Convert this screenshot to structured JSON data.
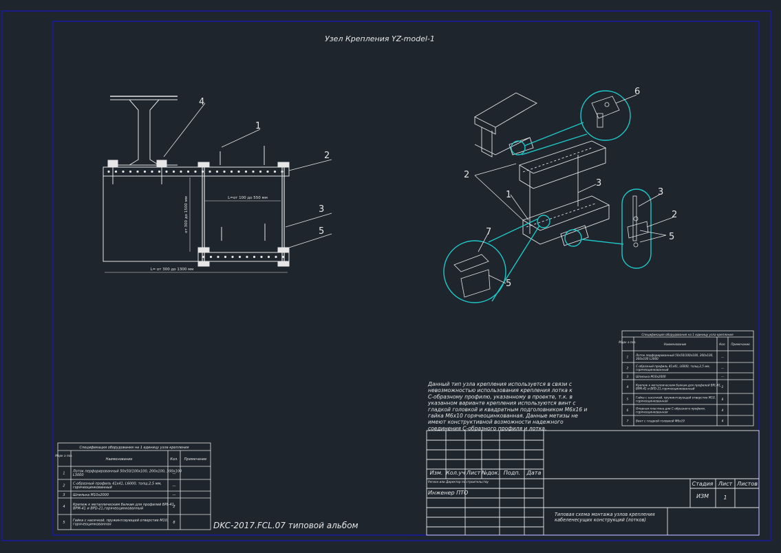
{
  "drawing": {
    "title": "Узел Крепления YZ-model-1",
    "album_label": "DKC-2017.FCL.07 типовой альбом",
    "left_view_callouts": [
      "4",
      "1",
      "2",
      "3",
      "5"
    ],
    "iso_view_callouts": [
      "6",
      "2",
      "1",
      "3",
      "3",
      "2",
      "5",
      "7",
      "5"
    ],
    "dimensions": {
      "inner_length": "L=от 100 до 550 мм",
      "height": "от 300 до 1500 мм",
      "total_length": "L= от 300 до 1300 мм"
    },
    "description": [
      "Данный тип узла крепления используется в связи с",
      "невозможностью использования крепления лотка к",
      "С-образному профилю, указанному в проекте, т.к. в",
      "указанном варианте крепления используются винт с",
      "гладкой головкой и квадратным подголовником М6х16 и",
      "гайка М6х10 горячеоцинкованная. Данные метизы не",
      "имеют конструктивной возможности надежного",
      "соединения С-образного профиля и лотка."
    ]
  },
  "spec_left": {
    "title": "Спецификация оборудования на 1 единицу узла крепления",
    "headers": [
      "Марк а поз.",
      "Наименование",
      "Кол.",
      "Примечание"
    ],
    "rows": [
      {
        "pos": "1",
        "name": "Лоток перфорированный 50х50/100х100, 200х100, 300х100 L3000",
        "qty": "—"
      },
      {
        "pos": "2",
        "name": "С-образный профиль 41х41, L6000, толщ.2,5 мм, горячеоцинкованный",
        "qty": "—"
      },
      {
        "pos": "3",
        "name": "Шпилька М10х2000",
        "qty": "—"
      },
      {
        "pos": "4",
        "name": "Крепеж к металлическим балкам для профилей BPL-41, BPM-41 и BPD-21,горячеоцинкованный",
        "qty": "2"
      },
      {
        "pos": "5",
        "name": "Гайка с насечкой, пружинтсвующей отверстие М10, горячеоцинкованная",
        "qty": "8"
      }
    ]
  },
  "spec_right": {
    "title": "Спецификация оборудования на 1 единицу узла крепления",
    "headers": [
      "Марк а поз.",
      "Наименование",
      "Кол.",
      "Примечание"
    ],
    "rows": [
      {
        "pos": "1",
        "name": "Лоток перфорированный 50х50/100х100, 200х100, 300х100 L3000",
        "qty": "—"
      },
      {
        "pos": "2",
        "name": "С-образный профиль 41х41, L6000, толщ.2,5 мм, горячеоцинкованный",
        "qty": "—"
      },
      {
        "pos": "3",
        "name": "Шпилька М10х2000",
        "qty": "—"
      },
      {
        "pos": "4",
        "name": "Крепеж к металлическим балкам для профилей BPL-41, BPM-41 и BPD-21,горячеоцинкованный",
        "qty": "2"
      },
      {
        "pos": "5",
        "name": "Гайка с насечкой, пружинтсвующей отверстие М10, горячеоцинкованная",
        "qty": "8"
      },
      {
        "pos": "6",
        "name": "Опорная пластина для С-образного профиля, горячеоцинкованная",
        "qty": "4"
      },
      {
        "pos": "7",
        "name": "Винт с гладкой головкой М6х19",
        "qty": "4"
      }
    ]
  },
  "stamp": {
    "cols": [
      "Изм.",
      "Кол.уч",
      "Лист",
      "№док.",
      "Подп.",
      "Дата"
    ],
    "row_note": "Регион или Директор по строительству",
    "engineer": "Инженер ПТО",
    "stage_label": "Стадия",
    "sheet_label": "Лист",
    "sheets_label": "Листов",
    "stage_value": "ИЗМ",
    "sheet_value": "1",
    "doc_title": "Типовая схема монтажа узлов крепления кабеленесущих конструкций (лотков)"
  },
  "colors": {
    "background": "#1e252d",
    "frame": "#1a1aa0",
    "lines": "#e6e6e6",
    "cyan": "#1fc8c8"
  }
}
